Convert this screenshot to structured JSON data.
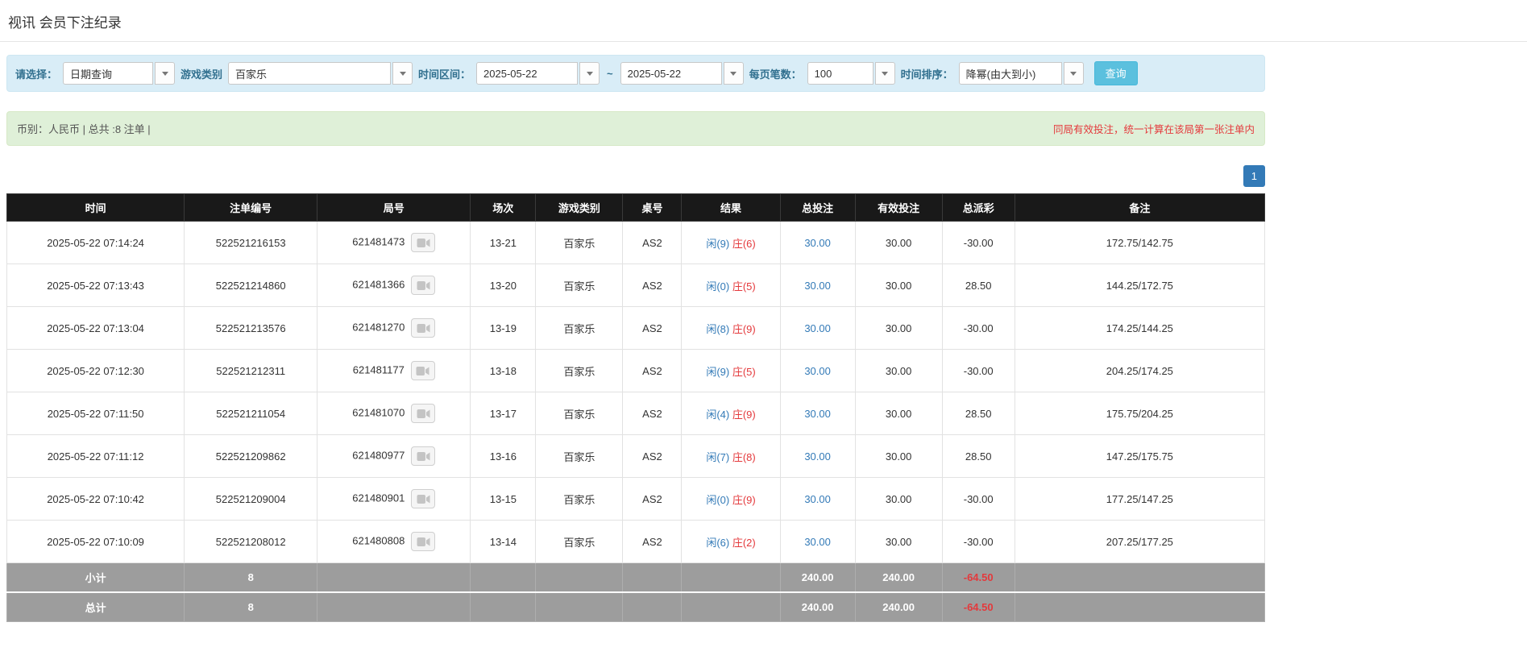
{
  "page": {
    "title": "视讯 会员下注纪录"
  },
  "filters": {
    "select_label": "请选择：",
    "select_value": "日期查询",
    "game_type_label": "游戏类别",
    "game_type_value": "百家乐",
    "range_label": "时间区间：",
    "date_from": "2025-05-22",
    "range_separator": "~",
    "date_to": "2025-05-22",
    "page_size_label": "每页笔数：",
    "page_size_value": "100",
    "sort_label": "时间排序：",
    "sort_value": "降幂(由大到小)",
    "search_button": "查询"
  },
  "summary": {
    "left": "币别：人民币 | 总共 :8 注单 |",
    "right": "同局有效投注，统一计算在该局第一张注单内"
  },
  "pagination": {
    "current_page": "1"
  },
  "table": {
    "headers": [
      "时间",
      "注单编号",
      "局号",
      "场次",
      "游戏类别",
      "桌号",
      "结果",
      "总投注",
      "有效投注",
      "总派彩",
      "备注"
    ],
    "rows": [
      {
        "time": "2025-05-22 07:14:24",
        "bet_id": "522521216153",
        "round_id": "621481473",
        "session": "13-21",
        "game": "百家乐",
        "table_no": "AS2",
        "result_player": "闲(9)",
        "result_banker": "庄(6)",
        "total_bet": "30.00",
        "valid_bet": "30.00",
        "payout": "-30.00",
        "remark": "172.75/142.75"
      },
      {
        "time": "2025-05-22 07:13:43",
        "bet_id": "522521214860",
        "round_id": "621481366",
        "session": "13-20",
        "game": "百家乐",
        "table_no": "AS2",
        "result_player": "闲(0)",
        "result_banker": "庄(5)",
        "total_bet": "30.00",
        "valid_bet": "30.00",
        "payout": "28.50",
        "remark": "144.25/172.75"
      },
      {
        "time": "2025-05-22 07:13:04",
        "bet_id": "522521213576",
        "round_id": "621481270",
        "session": "13-19",
        "game": "百家乐",
        "table_no": "AS2",
        "result_player": "闲(8)",
        "result_banker": "庄(9)",
        "total_bet": "30.00",
        "valid_bet": "30.00",
        "payout": "-30.00",
        "remark": "174.25/144.25"
      },
      {
        "time": "2025-05-22 07:12:30",
        "bet_id": "522521212311",
        "round_id": "621481177",
        "session": "13-18",
        "game": "百家乐",
        "table_no": "AS2",
        "result_player": "闲(9)",
        "result_banker": "庄(5)",
        "total_bet": "30.00",
        "valid_bet": "30.00",
        "payout": "-30.00",
        "remark": "204.25/174.25"
      },
      {
        "time": "2025-05-22 07:11:50",
        "bet_id": "522521211054",
        "round_id": "621481070",
        "session": "13-17",
        "game": "百家乐",
        "table_no": "AS2",
        "result_player": "闲(4)",
        "result_banker": "庄(9)",
        "total_bet": "30.00",
        "valid_bet": "30.00",
        "payout": "28.50",
        "remark": "175.75/204.25"
      },
      {
        "time": "2025-05-22 07:11:12",
        "bet_id": "522521209862",
        "round_id": "621480977",
        "session": "13-16",
        "game": "百家乐",
        "table_no": "AS2",
        "result_player": "闲(7)",
        "result_banker": "庄(8)",
        "total_bet": "30.00",
        "valid_bet": "30.00",
        "payout": "28.50",
        "remark": "147.25/175.75"
      },
      {
        "time": "2025-05-22 07:10:42",
        "bet_id": "522521209004",
        "round_id": "621480901",
        "session": "13-15",
        "game": "百家乐",
        "table_no": "AS2",
        "result_player": "闲(0)",
        "result_banker": "庄(9)",
        "total_bet": "30.00",
        "valid_bet": "30.00",
        "payout": "-30.00",
        "remark": "177.25/147.25"
      },
      {
        "time": "2025-05-22 07:10:09",
        "bet_id": "522521208012",
        "round_id": "621480808",
        "session": "13-14",
        "game": "百家乐",
        "table_no": "AS2",
        "result_player": "闲(6)",
        "result_banker": "庄(2)",
        "total_bet": "30.00",
        "valid_bet": "30.00",
        "payout": "-30.00",
        "remark": "207.25/177.25"
      }
    ],
    "subtotal": {
      "label": "小计",
      "count": "8",
      "total_bet": "240.00",
      "valid_bet": "240.00",
      "payout": "-64.50"
    },
    "total": {
      "label": "总计",
      "count": "8",
      "total_bet": "240.00",
      "valid_bet": "240.00",
      "payout": "-64.50"
    }
  },
  "colors": {
    "accent_blue": "#337ab7",
    "negative_red": "#e4393c",
    "search_button_bg": "#5bc0de",
    "table_header_bg": "#191919",
    "footer_row_bg": "#9d9d9d",
    "filter_bar_bg": "#d9edf7",
    "summary_bar_bg": "#dff0d8"
  }
}
